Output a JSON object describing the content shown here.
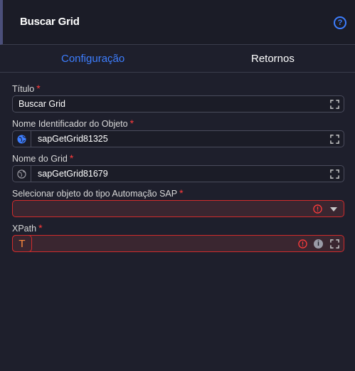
{
  "header": {
    "title": "Buscar Grid",
    "help_icon": "help-circle-icon",
    "help_glyph": "?"
  },
  "tabs": [
    {
      "label": "Configuração",
      "active": true
    },
    {
      "label": "Retornos",
      "active": false
    }
  ],
  "colors": {
    "accent": "#3d7eff",
    "required": "#ff3b3b",
    "error_border": "#d12c2c",
    "background": "#1e1f2c"
  },
  "fields": {
    "titulo": {
      "label": "Título",
      "required_mark": "*",
      "value": "Buscar Grid"
    },
    "nome_objeto": {
      "label": "Nome Identificador do Objeto",
      "required_mark": "*",
      "value": "sapGetGrid81325",
      "prefix_icon": "globe-icon"
    },
    "nome_grid": {
      "label": "Nome do Grid",
      "required_mark": "*",
      "value": "sapGetGrid81679",
      "prefix_icon": "globe-outline-icon"
    },
    "objeto_sap": {
      "label": "Selecionar objeto do tipo Automação SAP",
      "required_mark": "*",
      "value": "",
      "error": true
    },
    "xpath": {
      "label": "XPath",
      "required_mark": "*",
      "value": "",
      "prefix_glyph": "T",
      "info_glyph": "i",
      "error": true
    }
  }
}
